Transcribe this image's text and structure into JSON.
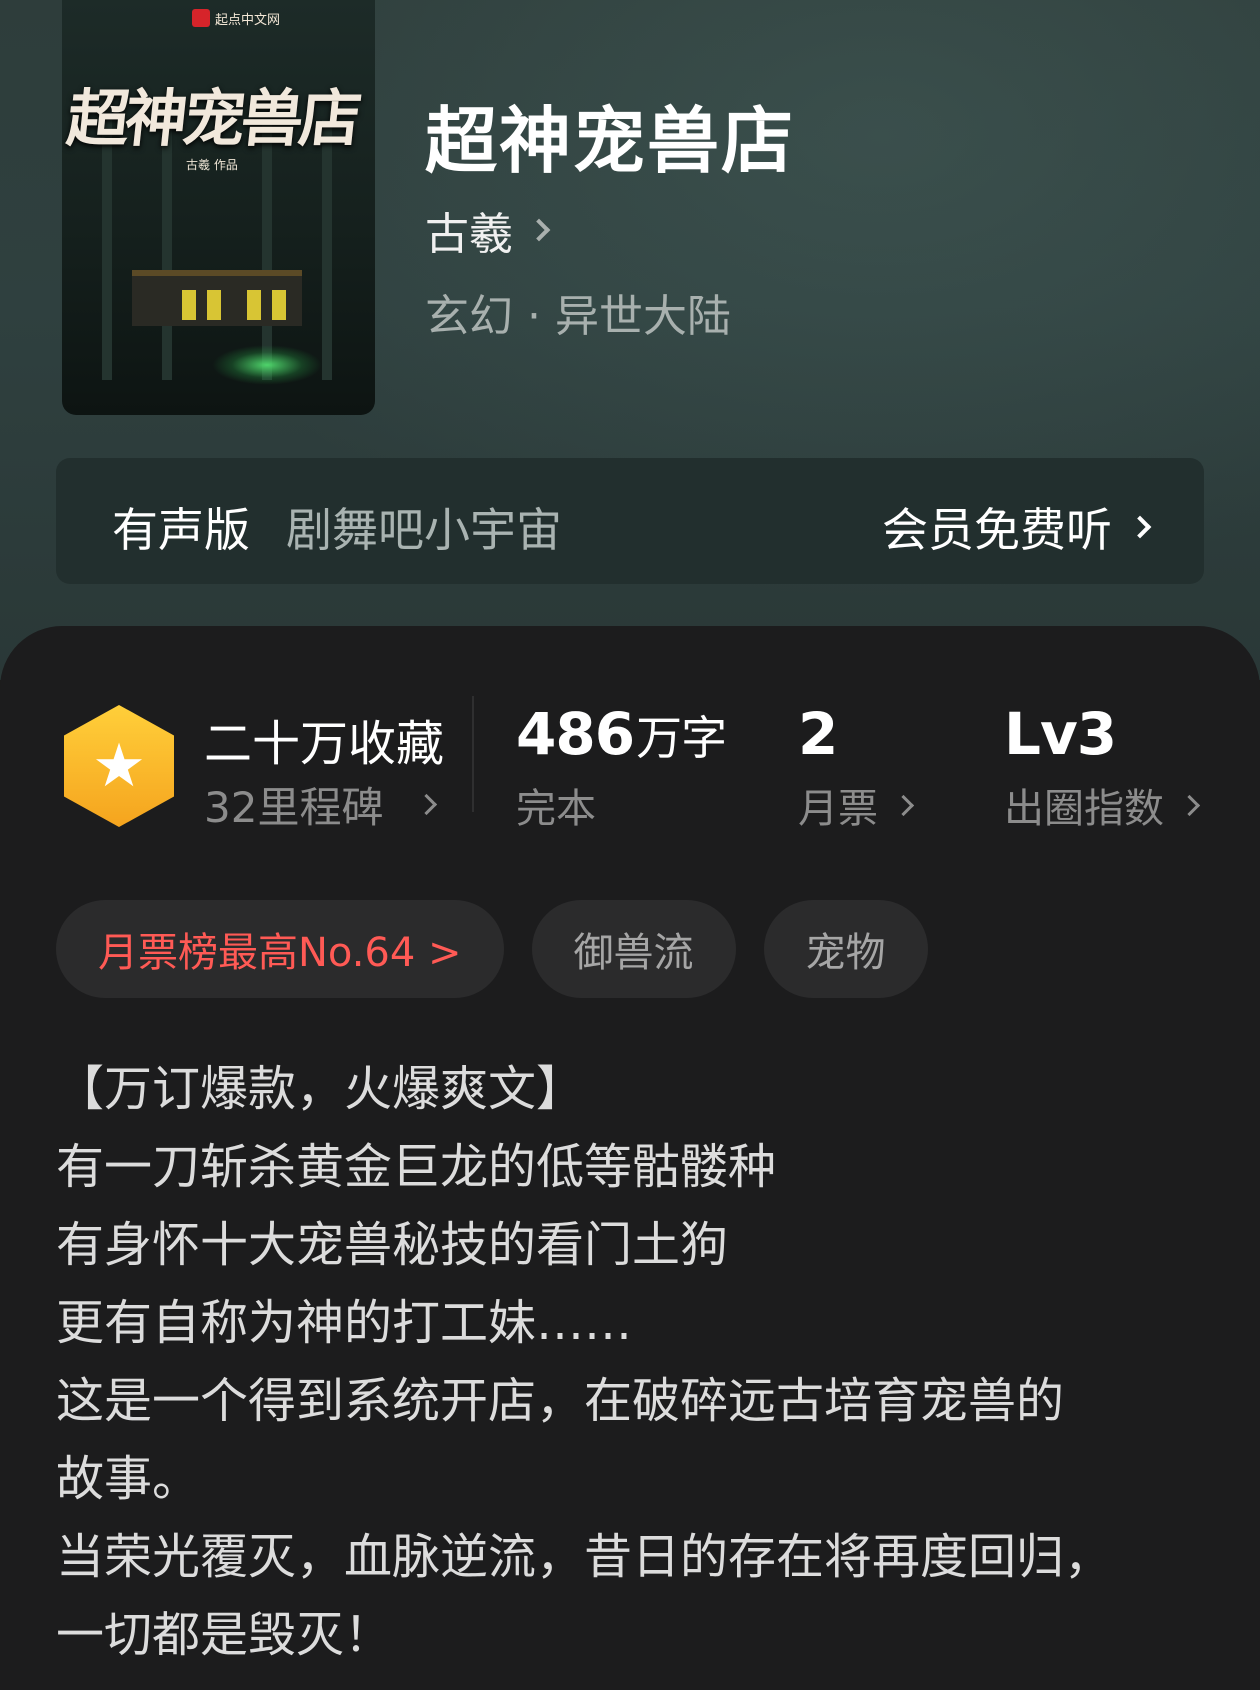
{
  "book": {
    "cover_logo": "起点中文网",
    "cover_title": "超神宠兽店",
    "cover_author": "古羲 作品",
    "title": "超神宠兽店",
    "author": "古羲",
    "genre": "玄幻 · 异世大陆"
  },
  "audio": {
    "label": "有声版",
    "narrator": "剧舞吧小宇宙",
    "listen": "会员免费听"
  },
  "stats": {
    "collect_title": "二十万收藏",
    "collect_sub": "32里程碑",
    "words_num": "486",
    "words_unit": "万字",
    "words_label": "完本",
    "tickets_num": "2",
    "tickets_label": "月票",
    "level_num": "Lv3",
    "level_label": "出圈指数"
  },
  "tags": {
    "rank": "月票榜最高No.64 >",
    "tag1": "御兽流",
    "tag2": "宠物"
  },
  "description": [
    "【万订爆款，火爆爽文】",
    "有一刀斩杀黄金巨龙的低等骷髅种",
    "有身怀十大宠兽秘技的看门土狗",
    "更有自称为神的打工妹……",
    "这是一个得到系统开店，在破碎远古培育宠兽的",
    "故事。",
    "当荣光覆灭，血脉逆流，昔日的存在将再度回归，",
    "一切都是毁灭！"
  ],
  "colors": {
    "accent_red": "#ff5a55",
    "badge_yellow": "#ffcf3a",
    "hero_bg": "#2f403f",
    "sheet_bg": "#1c1c1d"
  },
  "icons": {
    "badge": "star-icon",
    "more": "chevron-right-icon"
  }
}
